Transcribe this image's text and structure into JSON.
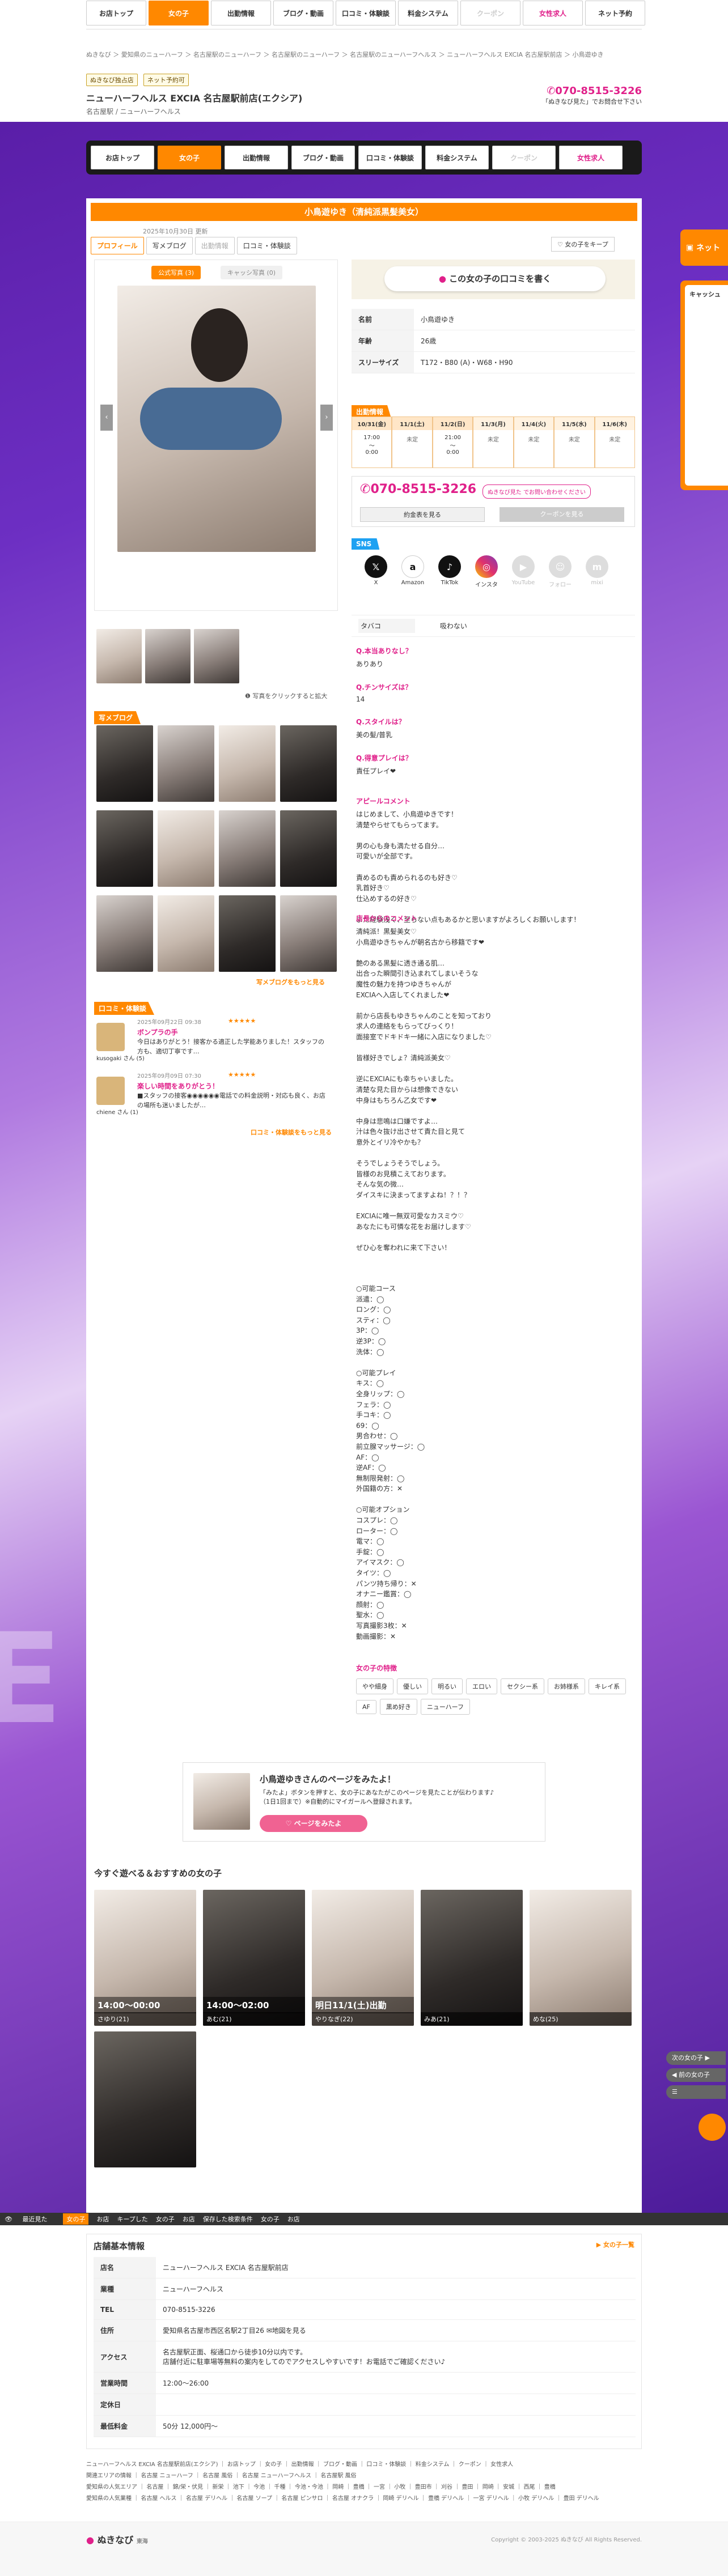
{
  "nav": {
    "items": [
      "お店トップ",
      "女の子",
      "出勤情報",
      "ブログ・動画",
      "口コミ・体験談",
      "料金システム",
      "クーポン",
      "女性求人",
      "ネット予約"
    ]
  },
  "breadcrumb": "ぬきなび ＞ 愛知県のニューハーフ ＞ 名古屋駅のニューハーフ ＞ 名古屋駅のニューハーフ ＞ 名古屋駅のニューハーフヘルス ＞ ニューハーフヘルス EXCIA 名古屋駅前店 ＞ 小鳥遊ゆき",
  "shop": {
    "tag1": "ぬきなび独占店",
    "tag2": "ネット予約可",
    "name": "ニューハーフヘルス EXCIA 名古屋駅前店(エクシア)",
    "sub": "名古屋駅 / ニューハーフヘルス",
    "phone": "070-8515-3226",
    "phone_note": "「ぬきなび見た」でお問合せ下さい"
  },
  "profile": {
    "title": "小鳥遊ゆき（清純派黒髪美女）",
    "updated": "2025年10月30日 更新",
    "tabs": [
      "プロフィール",
      "写メブログ",
      "出勤情報",
      "口コミ・体験談"
    ],
    "favorite": "女の子をキープ",
    "photo_tabs": [
      "公式写真 (3)",
      "キャッシ写真 (0)"
    ],
    "review_btn": "この女の子の口コミを書く",
    "table": [
      {
        "k": "名前",
        "v": "小鳥遊ゆき"
      },
      {
        "k": "年齢",
        "v": "26歳"
      },
      {
        "k": "スリーサイズ",
        "v": "T172・B80 (A)・W68・H90"
      }
    ],
    "schedule_title": "出勤情報",
    "schedule": [
      {
        "d": "10/31(金)",
        "v": "17:00\n〜\n0:00"
      },
      {
        "d": "11/1(土)",
        "v": "未定"
      },
      {
        "d": "11/2(日)",
        "v": "21:00\n〜\n0:00"
      },
      {
        "d": "11/3(月)",
        "v": "未定"
      },
      {
        "d": "11/4(火)",
        "v": "未定"
      },
      {
        "d": "11/5(水)",
        "v": "未定"
      },
      {
        "d": "11/6(木)",
        "v": "未定"
      }
    ],
    "phone": "070-8515-3226",
    "phone_note": "ぬきなび見た でお問い合わせください",
    "reserve": "約金表を見る",
    "coupon": "クーポンを見る",
    "sns_title": "SNS",
    "sns": [
      "X",
      "Amazon",
      "TikTok",
      "インスタ",
      "YouTube",
      "フォロー",
      "mixi"
    ],
    "photo_note": "写真をクリックすると拡大",
    "compare": "タバコ",
    "compare_v": "吸わない",
    "qa": [
      {
        "q": "Q.本当ありなし？",
        "a": "ありあり"
      },
      {
        "q": "Q.チンサイズは？",
        "a": "14"
      },
      {
        "q": "Q.スタイルは？",
        "a": "美の髪/普乳"
      },
      {
        "q": "Q.得意プレイは？",
        "a": "責任プレイ❤"
      }
    ],
    "appeal_title": "アピールコメント",
    "appeal": "はじめまして、小鳥遊ゆきです！\n清楚やらせてもらってます。\n\n男の心も身も満たせる自分…\n可愛いが全部です。\n\n責めるのも責められるのも好き♡\n乳首好き♡\n仕込めするの好き♡\n\nまだ経験浅く、至らない点もあるかと思いますがよろしくお願いします！",
    "shop_comment_title": "店長からのコメント",
    "shop_comment": "清純派！黒髪美女♡\n小鳥遊ゆきちゃんが朝名古から移籍です❤\n\n艶のある黒髪に透き通る肌…\n出合った瞬間引き込まれてしまいそうな\n魔性の魅力を持つゆきちゃんが\nEXCIAへ入店してくれました❤\n\n前から店長もゆきちゃんのことを知っており\n求人の連絡をもらってびっくり！\n面接室でドキドキ一緒に入店になりました♡\n\n皆様好きでしょ？清純派美女♡\n\n逆にEXCIAにも幸ちゃいました。\n清楚な見た目からは想像できない\n中身はもちろん乙女です❤\n\n中身は悲鳴は口嫌ですよ…\n汁は色々抜け出させて責た目と見て\n意外とイリ冷やかも？\n\nそうでしょうそうでしょう。\n皆様のお見積こえております。\nそんな気の微…\nダイスキに決まってますよね！？！？\n\nEXCIAに唯一無双可愛なカスミウ♡\nあなたにも可憐な花をお届けします♡\n\nぜひ心を奪われに来て下さい！",
    "options": "○可能コース\n派遣：◯\nロング：◯\nスティ：◯\n3P：◯\n逆3P：◯\n洗体：◯\n\n○可能プレイ\nキス：◯\n全身リップ：◯\nフェラ：◯\n手コキ：◯\n69：◯\n男合わせ：◯\n前立腺マッサージ：◯\nAF：◯\n逆AF：◯\n無制限発射：◯\n外国籍の方：✕\n\n○可能オプション\nコスプレ：◯\nローター：◯\n電マ：◯\n手錠：◯\nアイマスク：◯\nタイツ：◯\nパンツ持ち帰り：✕\nオナニー鑑賞：◯\n顔射：◯\n聖水：◯\n写真撮影3枚：✕\n動画撮影：✕",
    "feature_title": "女の子の特徴",
    "features": [
      "やや細身",
      "優しい",
      "明るい",
      "エロい",
      "セクシー系",
      "お姉様系",
      "キレイ系",
      "AF",
      "黒め好き",
      "ニューハーフ"
    ],
    "blog_title": "写メブログ",
    "blog_more": "写メブログをもっと見る",
    "review_title": "口コミ・体験談",
    "review_more": "口コミ・体験談をもっと見る",
    "reviews": [
      {
        "user": "kusogaki",
        "sub": "さん (5)",
        "date": "2025年09月22日 09:38",
        "stars": "★★★★★",
        "title": "ボンプラの手",
        "body": "今日はありがとう！接客かる適正した学能ありました！スタッフの方も、適切丁寧です…"
      },
      {
        "user": "chiene",
        "sub": "さん (1)",
        "date": "2025年09月09日 07:30",
        "stars": "★★★★★",
        "title": "楽しい時間をありがとう！",
        "body": "■スタッフの接客◉◉◉◉◉◉電話での料金説明・対応も良く、お店の場所も迷いましたが…"
      }
    ],
    "promo_title": "小鳥遊ゆきさんのページをみたよ！",
    "promo_text": "「みたよ」ボタンを押すと、女の子にあなたがこのページを見たことが伝わります♪\n（1日1回まで）※自動的にマイガールへ登録されます。",
    "promo_btn": "ページをみたよ"
  },
  "recommend": {
    "title": "今すぐ遊べる＆おすすめの女の子",
    "girls": [
      {
        "time": "14:00〜00:00",
        "name": "さゆり(21)"
      },
      {
        "time": "14:00〜02:00",
        "name": "あむ(21)"
      },
      {
        "time": "明日11/1(土)出勤",
        "name": "やりなぎ(22)"
      },
      {
        "time": "",
        "name": "みあ(21)"
      },
      {
        "time": "",
        "name": "めな(25)"
      },
      {
        "time": "",
        "name": ""
      }
    ]
  },
  "bottombar": [
    "最近見た",
    "女の子",
    "お店",
    "キープした",
    "女の子",
    "お店",
    "保存した検索条件",
    "女の子",
    "お店"
  ],
  "side": {
    "next": "次の女の子 ▶",
    "prev": "◀ 前の女の子",
    "banner1": "ネット",
    "banner2": "キャッシュ"
  },
  "footer": {
    "title": "店舗基本情報",
    "girls_link": "女の子一覧",
    "rows": [
      {
        "k": "店名",
        "v": "ニューハーフヘルス EXCIA 名古屋駅前店"
      },
      {
        "k": "業種",
        "v": "ニューハーフヘルス"
      },
      {
        "k": "TEL",
        "v": "070-8515-3226"
      },
      {
        "k": "住所",
        "v": "愛知県名古屋市西区名駅2丁目26 ✉地図を見る"
      },
      {
        "k": "アクセス",
        "v": "名古屋駅正面、桜通口から徒歩10分以内です。\n店舗付近に駐車場等無料の案内をしてのでアクセスしやすいです！お電話でご確認ください♪"
      },
      {
        "k": "営業時間",
        "v": "12:00〜26:00"
      },
      {
        "k": "定休日",
        "v": ""
      },
      {
        "k": "最低料金",
        "v": "50分 12,000円〜"
      }
    ],
    "links": "ニューハーフヘルス EXCIA 名古屋駅前店(エクシア) ｜ お店トップ ｜ 女の子 ｜ 出勤情報 ｜ ブログ・動画 ｜ 口コミ・体験談 ｜ 料金システム ｜ クーポン ｜ 女性求人",
    "links2": "関連エリアの情報 ｜ 名古屋 ニューハーフ ｜ 名古屋 風俗 ｜ 名古屋 ニューハーフヘルス ｜ 名古屋駅 風俗",
    "links3": "愛知県の人気エリア ｜ 名古屋 ｜ 錦/栄・伏見 ｜ 新栄 ｜ 池下 ｜ 今池 ｜ 千種 ｜ 今池・今池 ｜ 岡崎 ｜ 豊橋 ｜ 一宮 ｜ 小牧 ｜ 豊田市 ｜ 刈谷 ｜ 豊田 ｜ 岡崎 ｜ 安城 ｜ 西尾 ｜ 豊橋",
    "links4": "愛知県の人気業種 ｜ 名古屋 ヘルス ｜ 名古屋 デリヘル ｜ 名古屋 ソープ ｜ 名古屋 ピンサロ ｜ 名古屋 オナクラ ｜ 岡崎 デリヘル ｜ 豊橋 デリヘル ｜ 一宮 デリヘル ｜ 小牧 デリヘル ｜ 豊田 デリヘル",
    "logo": "ぬきなび",
    "logo_sub": "東海",
    "copyright": "Copyright © 2003-2025 ぬきなび All Rights Reserved."
  }
}
